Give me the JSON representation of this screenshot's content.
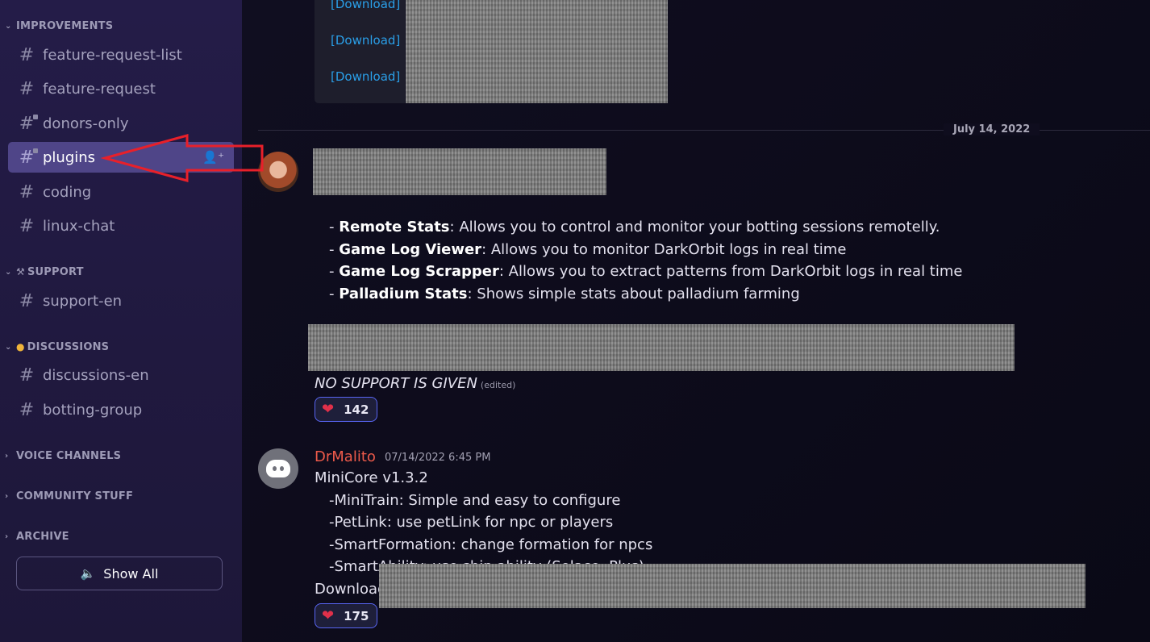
{
  "sidebar": {
    "categories": {
      "improvements": "IMPROVEMENTS",
      "support": "SUPPORT",
      "discussions": "DISCUSSIONS",
      "voice": "VOICE CHANNELS",
      "community": "COMMUNITY STUFF",
      "archive": "ARCHIVE"
    },
    "channels": {
      "feature_request_list": "feature-request-list",
      "feature_request": "feature-request",
      "donors_only": "donors-only",
      "plugins": "plugins",
      "coding": "coding",
      "linux_chat": "linux-chat",
      "support_en": "support-en",
      "discussions_en": "discussions-en",
      "botting_group": "botting-group"
    },
    "show_all": "Show All"
  },
  "main": {
    "downloads": [
      "[Download]",
      "[Download]",
      "[Download]"
    ],
    "date_divider": "July 14, 2022",
    "message1": {
      "features": [
        {
          "name": "Remote Stats",
          "desc": ": Allows you to control and monitor your botting sessions remotelly."
        },
        {
          "name": "Game Log Viewer",
          "desc": ": Allows you to monitor DarkOrbit logs in real time"
        },
        {
          "name": "Game Log Scrapper",
          "desc": ": Allows you to extract patterns from DarkOrbit logs in real time"
        },
        {
          "name": "Palladium Stats",
          "desc": ":  Shows simple stats about palladium farming"
        }
      ],
      "note": "NO SUPPORT IS GIVEN",
      "edited": "(edited)",
      "reaction_count": "142"
    },
    "message2": {
      "author": "DrMalito",
      "timestamp": "07/14/2022 6:45 PM",
      "title": "MiniCore v1.3.2",
      "items": [
        "-MiniTrain: Simple and easy to configure",
        "-PetLink: use petLink for npc or players",
        "-SmartFormation: change formation for npcs",
        "-SmartAbility: use ship ability (Solace, Plus)"
      ],
      "download_label": "Download:",
      "reaction_count": "175"
    }
  },
  "colors": {
    "accent": "#5865f2",
    "author_name": "#ed5a4a",
    "link": "#2a9fe8",
    "annotation_arrow": "#e8202a"
  }
}
